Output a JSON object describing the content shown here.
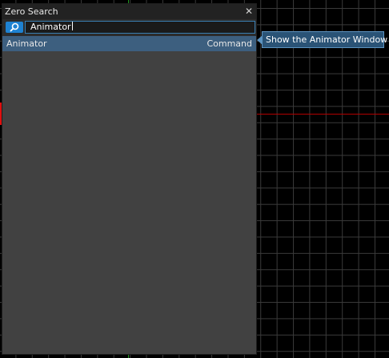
{
  "window": {
    "title": "Zero Search",
    "close_icon": "close-icon"
  },
  "search": {
    "value": "Animator",
    "icon": "search-icon"
  },
  "results": [
    {
      "name": "Animator",
      "type": "Command"
    }
  ],
  "tooltip": {
    "text": "Show the Animator Window"
  },
  "colors": {
    "panel": "#414141",
    "titlebar": "#222222",
    "selected_row": "#3d5f7f",
    "accent": "#1e82d2",
    "tooltip_bg": "#2a5376",
    "tooltip_border": "#5c93c0",
    "grid_line": "#3a3a3a",
    "x_axis": "#b00000",
    "y_axis": "#1f9a1f"
  }
}
